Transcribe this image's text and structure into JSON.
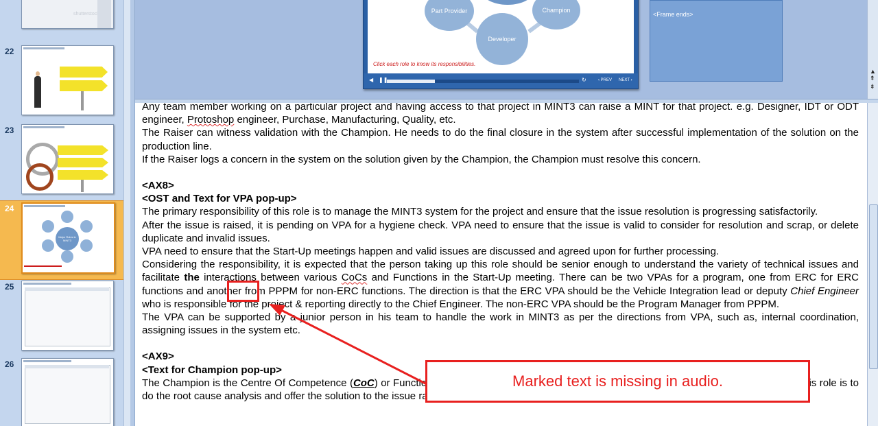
{
  "thumbnails": [
    {
      "number": "",
      "selected": false,
      "watermark": "shutterstock"
    },
    {
      "number": "22",
      "selected": false
    },
    {
      "number": "23",
      "selected": false,
      "center_text": "Major Roles in MINT3"
    },
    {
      "number": "24",
      "selected": true,
      "center_text": "Major Roles in MINT3"
    },
    {
      "number": "25",
      "selected": false
    },
    {
      "number": "26",
      "selected": false
    }
  ],
  "slide": {
    "roles": [
      "Part Provider",
      "Developer",
      "Champion"
    ],
    "click_note": "Click each role to know its responsibilities.",
    "prev_label": "PREV",
    "next_label": "NEXT",
    "progress": 0.25
  },
  "frame_box": {
    "label": "<Frame ends>"
  },
  "notes": {
    "p1": "Any team member working on a particular project and having access to that project in MINT3 can raise a MINT for that project. e.g. Designer, IDT or ODT engineer, ",
    "p1_squiggle": "Protoshop",
    "p1_end": " engineer, Purchase, Manufacturing, Quality, etc.",
    "p2": "The Raiser can witness validation with the Champion. He needs to do the final closure in the system after successful implementation of the solution on the production line.",
    "p3": "If the Raiser logs a concern in the system on the solution given by the Champion, the Champion must resolve this concern.",
    "h1": "<AX8>",
    "h2": "<OST and Text for VPA pop-up>",
    "p4": "The primary responsibility of this role is to manage the MINT3 system for the project and ensure that the issue resolution is progressing satisfactorily.",
    "p5": "After the issue is raised, it is pending on VPA for a hygiene check. VPA need to ensure that the issue is valid to consider for resolution and scrap, or delete duplicate and invalid issues.",
    "p6": "VPA need to ensure that the Start-Up meetings happen and valid issues are discussed and agreed upon for further processing.",
    "p7a": "Considering the responsibility, it is expected that the person taking up this role should be senior enough to understand the variety of technical issues and facilitate ",
    "p7_bold": "the",
    "p7b": "interactions between various ",
    "p7_squiggle": "CoCs",
    "p7c": " and Functions in the Start-Up meeting. There can be two VPAs for a program, one from ERC for ERC functions and another from PPPM for non-ERC functions. The direction is that the ERC VPA should be the Vehicle Integration lead or deputy ",
    "p7_italic": "Chief Engineer",
    "p7d": " who is responsible for the project & reporting directly to the Chief Engineer. The non-ERC VPA should be the Program Manager from PPPM.",
    "p8": "The VPA can be supported by a junior person in his team to handle the work in MINT3 as per the directions from VPA, such as, internal coordination, assigning issues in the system etc.",
    "h3": "<AX9>",
    "h4": "<Text for Champion pop-up>",
    "p9a": "The Champion is the Centre Of Competence (",
    "p9_coc": "CoC",
    "p9b": ") or Functional Lead who is a part of the project Cross Functional Team. The responsibility of this role is to do the root cause analysis and offer the solution to the issue raised. Hence, the person nominated for this role should be experienced and"
  },
  "annotation": {
    "callout_text": "Marked text is missing in audio.",
    "color": "#e8201f"
  }
}
